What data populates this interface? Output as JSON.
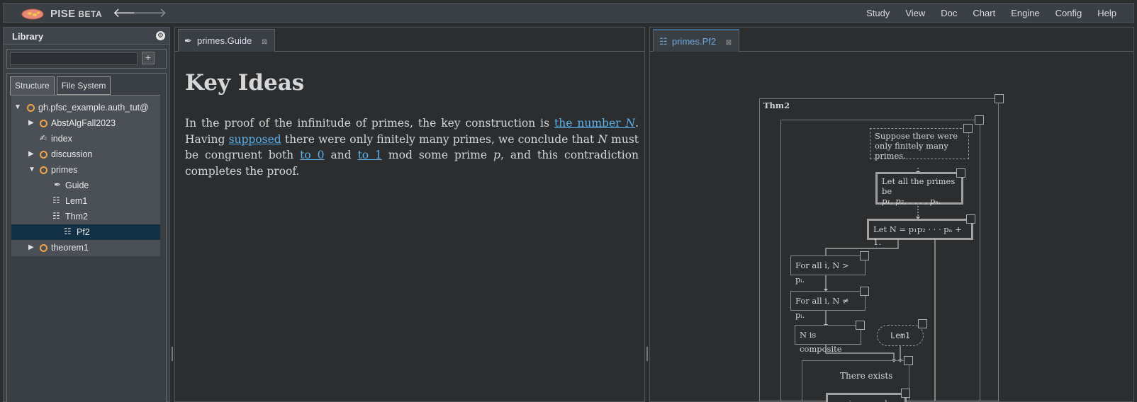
{
  "app": {
    "name": "PISE",
    "badge": "BETA",
    "back_glyph": "🡐",
    "forward_glyph": "🡒"
  },
  "menu": [
    "Study",
    "View",
    "Doc",
    "Chart",
    "Engine",
    "Config",
    "Help"
  ],
  "library": {
    "title": "Library",
    "search_value": "",
    "add_label": "+",
    "tabs": [
      "Structure",
      "File System"
    ],
    "tree": [
      {
        "label": "gh.pfsc_example.auth_tut@",
        "kind": "module",
        "expanded": true,
        "level": 0
      },
      {
        "label": "AbstAlgFall2023",
        "kind": "module",
        "expanded": false,
        "level": 1
      },
      {
        "label": "index",
        "kind": "anno",
        "level": 1
      },
      {
        "label": "discussion",
        "kind": "module",
        "expanded": false,
        "level": 1
      },
      {
        "label": "primes",
        "kind": "module",
        "expanded": true,
        "level": 1
      },
      {
        "label": "Guide",
        "kind": "guide",
        "level": 2
      },
      {
        "label": "Lem1",
        "kind": "deduc",
        "level": 2
      },
      {
        "label": "Thm2",
        "kind": "deduc",
        "level": 2
      },
      {
        "label": "Pf2",
        "kind": "deduc",
        "level": 3,
        "selected": true
      },
      {
        "label": "theorem1",
        "kind": "module",
        "expanded": false,
        "level": 1
      }
    ]
  },
  "left_tab": {
    "label": "primes.Guide",
    "close": "⊠"
  },
  "right_tab": {
    "label": "primes.Pf2",
    "close": "⊠"
  },
  "doc": {
    "heading": "Key Ideas",
    "p_1": "In the proof of the infinitude of primes, the key construction is ",
    "link_number": "the number ",
    "link_number_var": "N",
    "p_2": ". Having ",
    "link_supposed": "supposed",
    "p_3": " there were only finitely many primes, we conclude that ",
    "var_N": "N",
    "p_4": " must be congruent both ",
    "link_to0": "to 0",
    "p_5": " and ",
    "link_to1": "to 1",
    "p_6": " mod some prime ",
    "var_p": "p",
    "p_7": ", and this contradiction completes the proof."
  },
  "diagram": {
    "outer_label": "Thm2",
    "suppose": "Suppose there were only finitely many primes.",
    "let_primes_1": "Let all the primes be",
    "let_primes_2": "p₁, p₂, . . . , pₙ.",
    "let_N": "Let N = p₁p₂ · · · pₙ + 1.",
    "forall_gt": "For all i, N > pᵢ.",
    "forall_ne": "For all i, N ≠ pᵢ.",
    "composite": "N is composite",
    "lem1": "Lem1",
    "exists": "There exists",
    "prime_p": "a prime number p"
  }
}
